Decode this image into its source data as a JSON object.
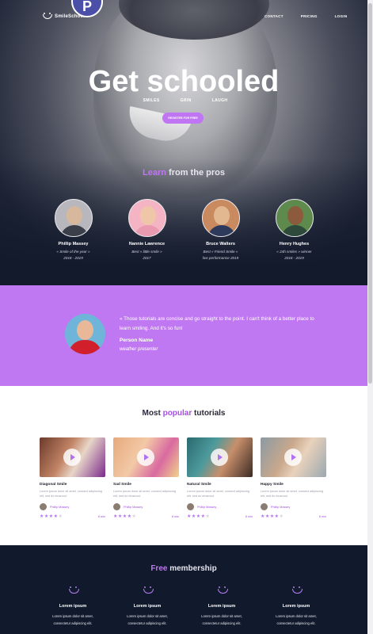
{
  "header": {
    "logo_text": "SmileSchool",
    "badge_letter": "P",
    "nav": [
      "CONTACT",
      "PRICING",
      "LOGIN"
    ]
  },
  "hero": {
    "title": "Get schooled",
    "tags": [
      "SMILES",
      "GRIN",
      "LAUGH"
    ],
    "cta_label": "REGISTER FOR FREE"
  },
  "learn": {
    "highlight": "Learn",
    "rest": " from the pros"
  },
  "pros": [
    {
      "name": "Phillip Massey",
      "desc_line1": "« Smile of the year »",
      "desc_line2": "2018 - 2019"
    },
    {
      "name": "Nannie Lawrence",
      "desc_line1": "Best « little smile »",
      "desc_line2": "2017"
    },
    {
      "name": "Bruce Walters",
      "desc_line1": "Best « Friend Smile »",
      "desc_line2": "live performance 2019"
    },
    {
      "name": "Henry Hughes",
      "desc_line1": "« 24h smiles » winner",
      "desc_line2": "2018 - 2019"
    }
  ],
  "testimonial": {
    "quote": "« Those tutorials are concise and go straight to the point. I can't think of a better place to learn smiling. And it's so fun!",
    "name": "Person Name",
    "role": "weather presenter"
  },
  "tutorials": {
    "title_pre": "Most ",
    "title_highlight": "popular",
    "title_post": " tutorials",
    "cards": [
      {
        "title": "Diagonal Smile",
        "desc": "Lorem ipsum dolor sit amet, consect adipiscing elit, sed do eiusmod.",
        "author": "Phillip Massey",
        "rating": 4,
        "duration": "8 min"
      },
      {
        "title": "Sad Smile",
        "desc": "Lorem ipsum dolor sit amet, consect adipiscing elit, sed do eiusmod.",
        "author": "Phillip Massey",
        "rating": 4,
        "duration": "8 min"
      },
      {
        "title": "Natural Smile",
        "desc": "Lorem ipsum dolor sit amet, consect adipiscing elit, sed do eiusmod.",
        "author": "Phillip Massey",
        "rating": 4,
        "duration": "8 min"
      },
      {
        "title": "Happy Smile",
        "desc": "Lorem ipsum dolor sit amet, consect adipiscing elit, sed do eiusmod.",
        "author": "Phillip Massey",
        "rating": 4,
        "duration": "8 min"
      }
    ]
  },
  "membership": {
    "highlight": "Free",
    "rest": " membership",
    "columns": [
      {
        "heading": "Lorem ipsum",
        "line1": "Lorem ipsum dolor sit amet,",
        "line2": "consectetur adipiscing elit."
      },
      {
        "heading": "Lorem ipsum",
        "line1": "Lorem ipsum dolor sit amet,",
        "line2": "consectetur adipiscing elit."
      },
      {
        "heading": "Lorem ipsum",
        "line1": "Lorem ipsum dolor sit amet,",
        "line2": "consectetur adipiscing elit."
      },
      {
        "heading": "Lorem ipsum",
        "line1": "Lorem ipsum dolor sit amet,",
        "line2": "consectetur adipiscing elit."
      }
    ]
  },
  "colors": {
    "accent": "#c075f2",
    "dark": "#111a2c",
    "purple_text": "#a34fe0"
  }
}
